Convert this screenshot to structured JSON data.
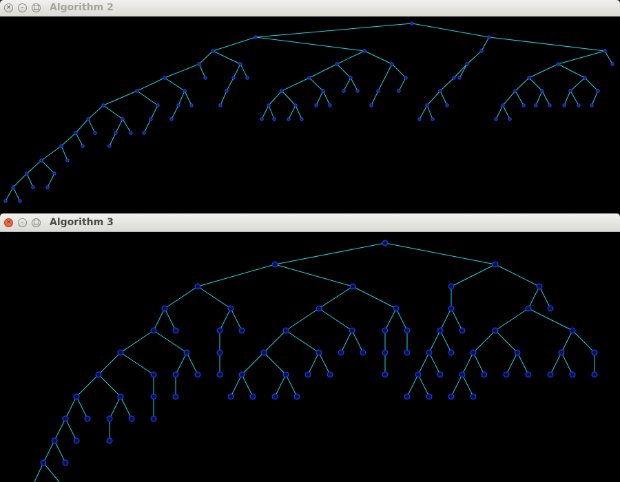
{
  "windows": [
    {
      "title": "Algorithm 2",
      "active": false
    },
    {
      "title": "Algorithm 3",
      "active": true
    }
  ],
  "controls": {
    "close_glyph": "×",
    "minimize_glyph": "–",
    "maximize_glyph": "□"
  },
  "colors": {
    "canvas": "#000000",
    "edge": "#22d6e8",
    "node_fill": "#0b1f9c",
    "node_stroke": "#2e4de0"
  }
}
